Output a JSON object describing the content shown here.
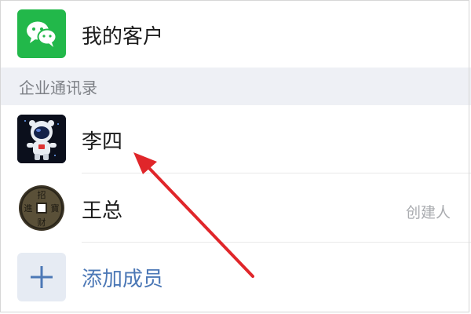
{
  "top_row": {
    "label": "我的客户",
    "icon": "wechat-icon",
    "icon_bg": "#22b84a"
  },
  "section": {
    "title": "企业通讯录"
  },
  "members": [
    {
      "name": "李四",
      "avatar": "astronaut-avatar",
      "tag": ""
    },
    {
      "name": "王总",
      "avatar": "coin-avatar",
      "tag": "创建人"
    }
  ],
  "add_member": {
    "label": "添加成员",
    "icon": "plus-icon",
    "color": "#4c78b6"
  },
  "annotation": {
    "icon": "red-arrow-icon",
    "color": "#e0262a"
  }
}
